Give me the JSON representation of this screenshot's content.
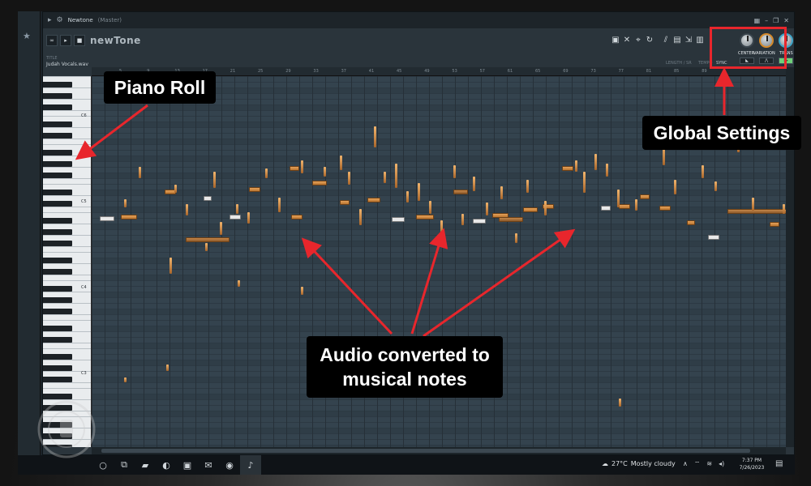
{
  "titlebar": {
    "title": "Newtone",
    "subtitle": "(Master)"
  },
  "toolbar": {
    "logo": "newTone",
    "title_label": "TITLE",
    "title_value": "Judah Vocals.wav",
    "length_label": "LENGTH / SR",
    "length_value": "12270384",
    "tempo_label": "TEMPO",
    "sync_label": "SYNC"
  },
  "knobs": [
    {
      "label": "CENTER"
    },
    {
      "label": "VARIATION"
    },
    {
      "label": "TRANS"
    }
  ],
  "ruler_marks": [
    "5",
    "9",
    "13",
    "17",
    "21",
    "25",
    "29",
    "33",
    "37",
    "41",
    "45",
    "49",
    "53",
    "57",
    "61",
    "65",
    "69",
    "73",
    "77",
    "81",
    "85",
    "89"
  ],
  "octaves": [
    "C6",
    "C5",
    "C4",
    "C3"
  ],
  "taskbar": {
    "temperature": "27°C",
    "weather": "Mostly cloudy",
    "time": "7:37 PM",
    "date": "7/26/2023"
  },
  "callouts": {
    "piano_roll": "Piano Roll",
    "global_settings": "Global Settings",
    "audio_line1": "Audio converted to",
    "audio_line2": "musical notes"
  },
  "colors": {
    "highlight": "#e8262c",
    "note": "#e6a25a",
    "grid": "#34434e",
    "trans_on": "#6fd17a"
  }
}
